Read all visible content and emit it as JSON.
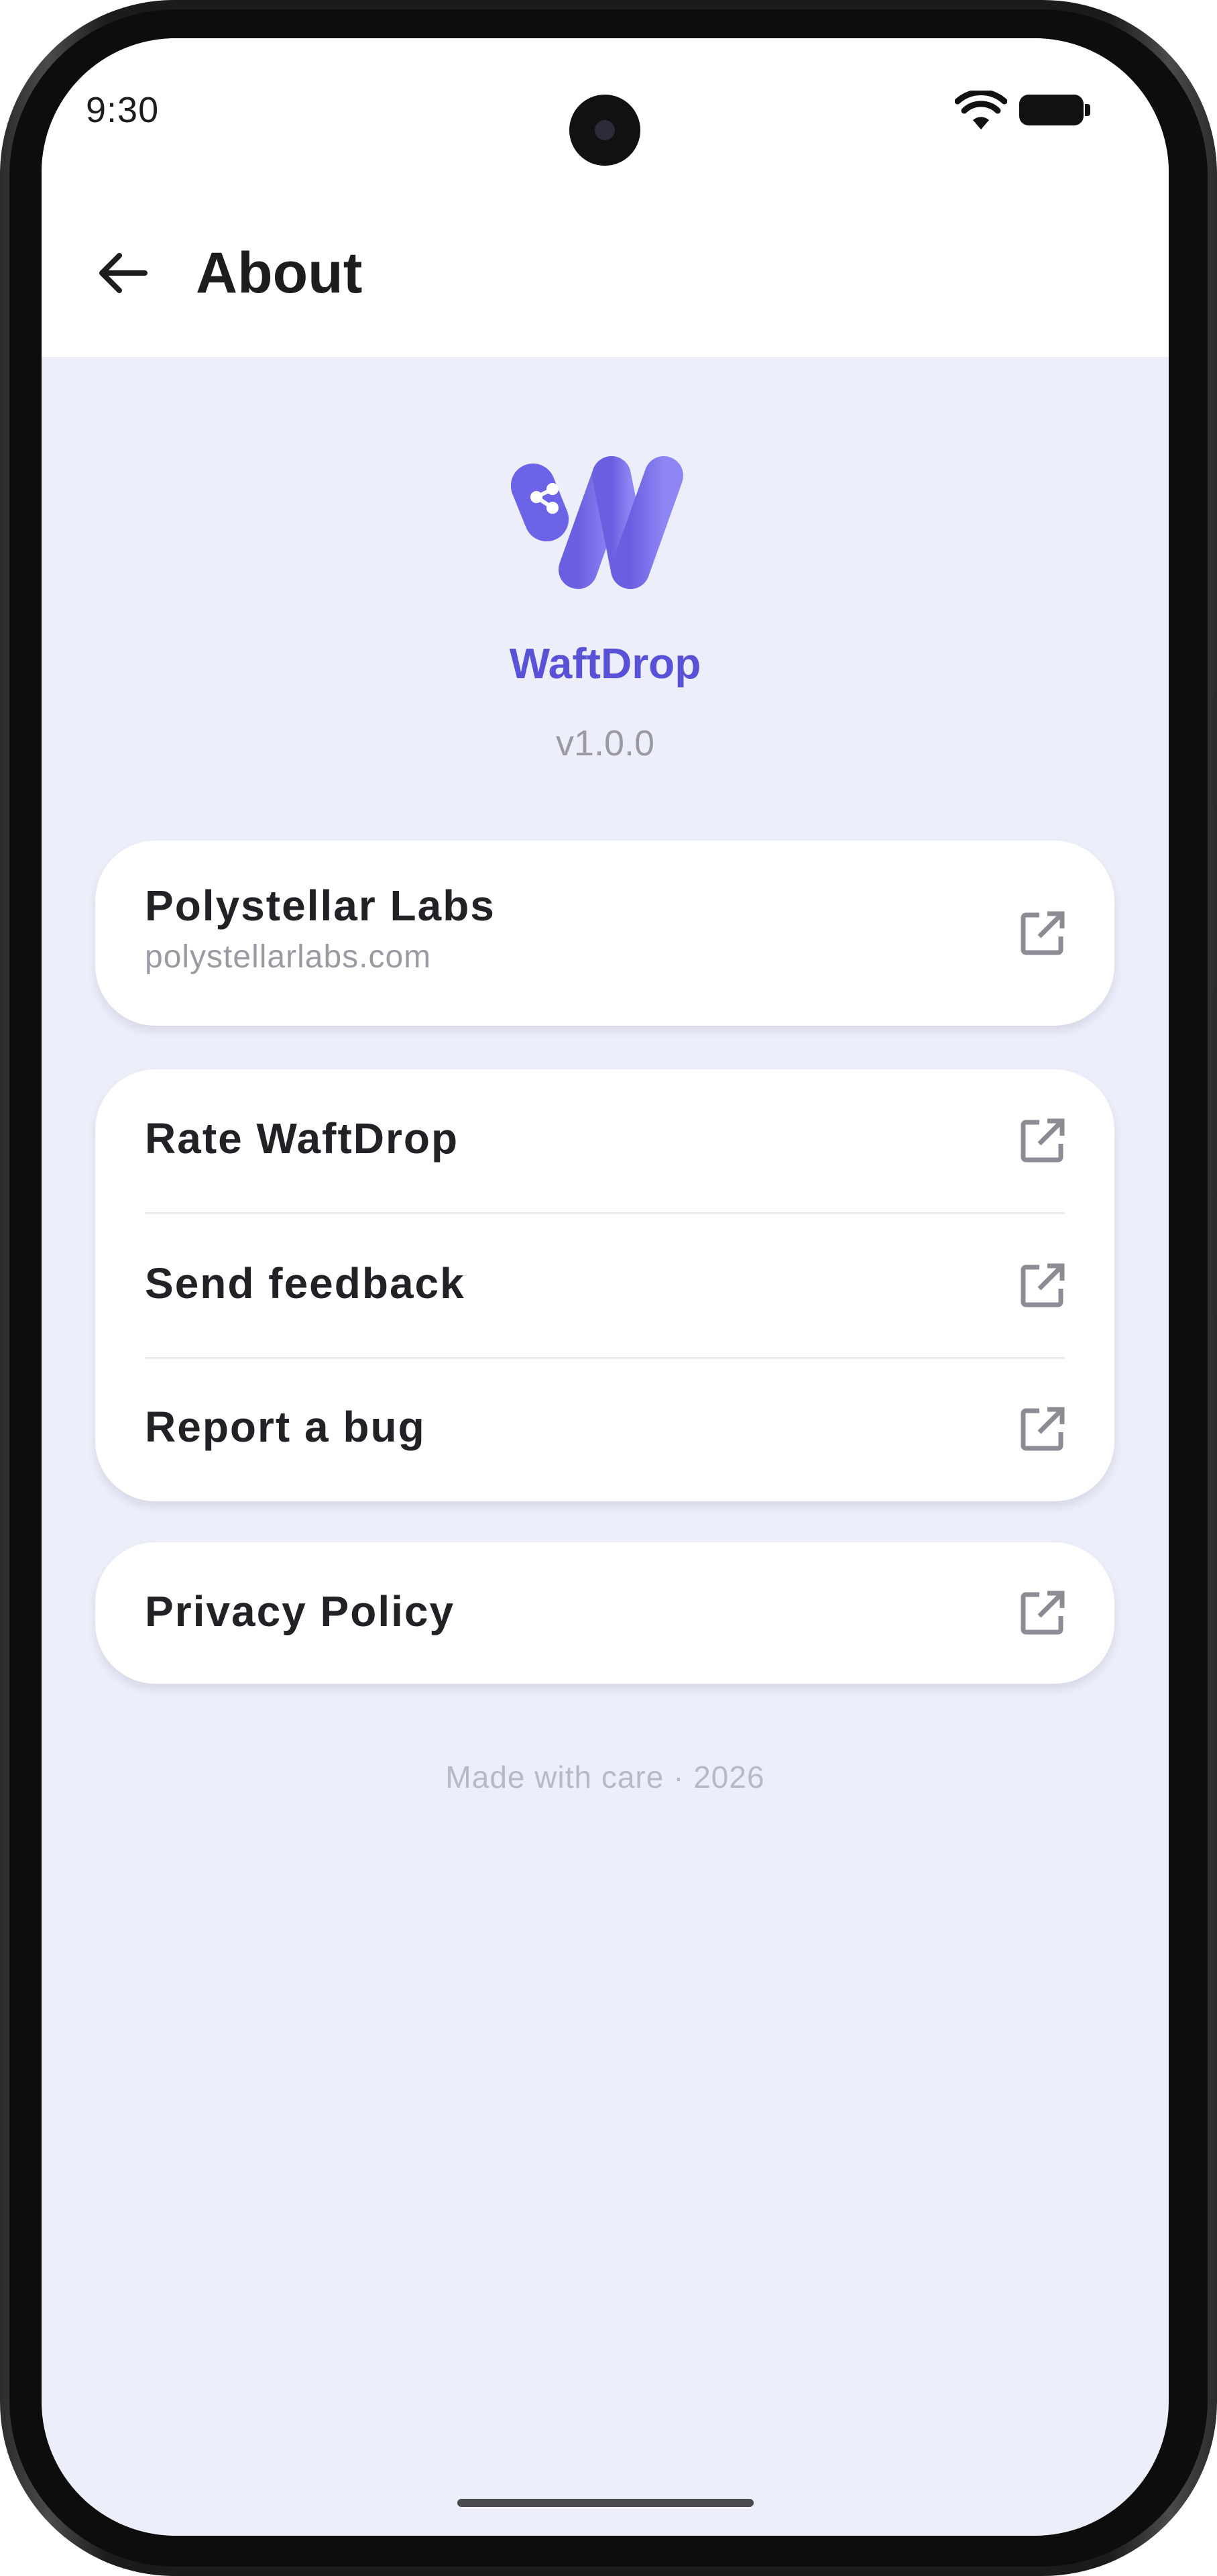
{
  "status_bar": {
    "time": "9:30",
    "wifi_icon": "wifi-icon",
    "battery_icon": "battery-icon"
  },
  "header": {
    "back_icon": "arrow-left-icon",
    "title": "About"
  },
  "app": {
    "logo_icon": "waftdrop-logo-icon",
    "name": "WaftDrop",
    "version": "v1.0.0"
  },
  "company_card": {
    "name": "Polystellar Labs",
    "url": "polystellarlabs.com",
    "icon": "external-link-icon"
  },
  "actions_card": {
    "items": [
      {
        "label": "Rate WaftDrop",
        "icon": "external-link-icon"
      },
      {
        "label": "Send feedback",
        "icon": "external-link-icon"
      },
      {
        "label": "Report a bug",
        "icon": "external-link-icon"
      }
    ]
  },
  "privacy_card": {
    "label": "Privacy Policy",
    "icon": "external-link-icon"
  },
  "footer": {
    "text": "Made with care · 2026"
  },
  "colors": {
    "accent": "#5a52d6",
    "screen_background": "#eceefa",
    "card_background": "#ffffff",
    "secondary_text": "#9a9aa2"
  }
}
